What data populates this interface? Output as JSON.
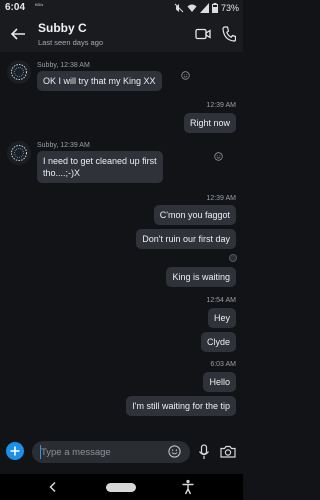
{
  "status_bar": {
    "time": "6:04",
    "sub_label": "KB/s",
    "battery_text": "73%"
  },
  "header": {
    "contact_name": "Subby C",
    "last_seen": "Last seen days ago"
  },
  "messages": [
    {
      "side": "incoming",
      "meta": "Subby, 12:38 AM",
      "lines": [
        "OK I will try that my King XX"
      ]
    },
    {
      "side": "outgoing",
      "time": "12:39 AM",
      "lines": [
        "Right now"
      ]
    },
    {
      "side": "incoming",
      "meta": "Subby, 12:39 AM",
      "lines": [
        "I need to get cleaned up first",
        "tho....;-)X"
      ]
    },
    {
      "side": "outgoing",
      "time": "12:39 AM",
      "lines": [
        "C'mon you faggot"
      ]
    },
    {
      "side": "outgoing",
      "lines": [
        "Don't ruin our first day"
      ]
    },
    {
      "side": "outgoing",
      "lines": [
        "King is waiting"
      ]
    },
    {
      "side": "outgoing",
      "time": "12:54 AM",
      "lines": [
        "Hey"
      ]
    },
    {
      "side": "outgoing",
      "lines": [
        "Clyde"
      ]
    },
    {
      "side": "outgoing",
      "time": "6:03 AM",
      "lines": [
        "Hello"
      ]
    },
    {
      "side": "outgoing",
      "lines": [
        "I'm still waiting for the tip"
      ]
    }
  ],
  "composer": {
    "placeholder": "Type a message"
  },
  "colors": {
    "background": "#111316",
    "bar": "#191b1f",
    "bubble": "#2f3238",
    "accent": "#1d8fe6"
  },
  "icons": [
    "back-arrow-icon",
    "video-call-icon",
    "phone-icon",
    "avatar-icon",
    "reaction-icon",
    "seen-avatar-icon",
    "plus-icon",
    "emoji-icon",
    "mic-icon",
    "camera-icon",
    "nav-back-icon",
    "nav-home-icon",
    "accessibility-icon"
  ]
}
